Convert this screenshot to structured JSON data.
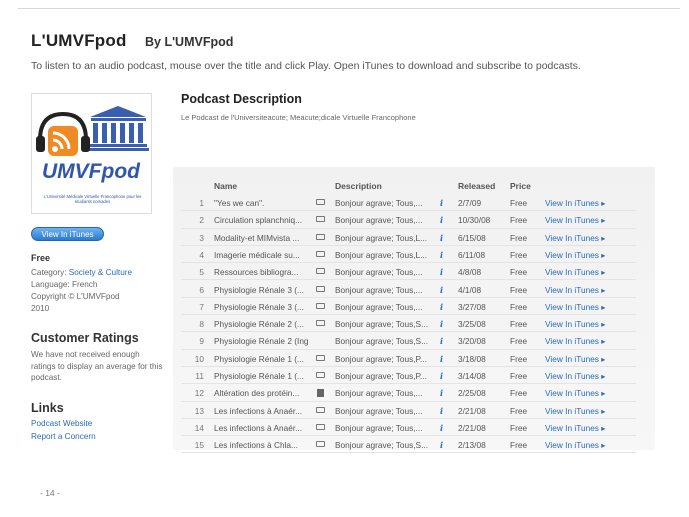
{
  "header": {
    "title": "L'UMVFpod",
    "by": "By L'UMVFpod",
    "subtitle": "To listen to an audio podcast, mouse over the title and click Play. Open iTunes to download and subscribe to podcasts."
  },
  "artwork": {
    "logo_text": "UMVFpod",
    "caption": "L'Université Médicale Virtuelle Francophone pour les étudiants nomades"
  },
  "sidebar": {
    "view_button": "View In iTunes",
    "price": "Free",
    "category_label": "Category: ",
    "category_value": "Society & Culture",
    "language": "Language: French",
    "copyright": "Copyright © L'UMVFpod",
    "year": "2010",
    "ratings_heading": "Customer Ratings",
    "ratings_text": "We have not received enough ratings to display an average for this podcast.",
    "links_heading": "Links",
    "links": [
      "Podcast Website",
      "Report a Concern"
    ]
  },
  "description": {
    "heading": "Podcast Description",
    "text": "Le Podcast de l'Universiteacute; Meacute;dicale Virtuelle Francophone"
  },
  "table": {
    "columns": {
      "name": "Name",
      "description": "Description",
      "released": "Released",
      "price": "Price"
    },
    "view_label": "View In iTunes ▸",
    "rows": [
      {
        "num": "1",
        "name": "\"Yes we can\".",
        "icon": "video",
        "desc": "Bonjour agrave; Tous,...",
        "rel": "2/7/09",
        "price": "Free"
      },
      {
        "num": "2",
        "name": "Circulation splanchniq...",
        "icon": "video",
        "desc": "Bonjour agrave; Tous,...",
        "rel": "10/30/08",
        "price": "Free"
      },
      {
        "num": "3",
        "name": "Modality-et MIMvista ...",
        "icon": "video",
        "desc": "Bonjour agrave; Tous,L...",
        "rel": "6/15/08",
        "price": "Free"
      },
      {
        "num": "4",
        "name": "Imagerie médicale su...",
        "icon": "video",
        "desc": "Bonjour agrave; Tous,L...",
        "rel": "6/11/08",
        "price": "Free"
      },
      {
        "num": "5",
        "name": "Ressources bibliogra...",
        "icon": "video",
        "desc": "Bonjour agrave; Tous,...",
        "rel": "4/8/08",
        "price": "Free"
      },
      {
        "num": "6",
        "name": "Physiologie Rénale 3 (...",
        "icon": "video",
        "desc": "Bonjour agrave; Tous,...",
        "rel": "4/1/08",
        "price": "Free"
      },
      {
        "num": "7",
        "name": "Physiologie Rénale 3 (...",
        "icon": "video",
        "desc": "Bonjour agrave; Tous,...",
        "rel": "3/27/08",
        "price": "Free"
      },
      {
        "num": "8",
        "name": "Physiologie Rénale 2 (...",
        "icon": "video",
        "desc": "Bonjour agrave; Tous,S...",
        "rel": "3/25/08",
        "price": "Free"
      },
      {
        "num": "9",
        "name": "Physiologie Rénale 2 (Ing...",
        "icon": "none",
        "desc": "Bonjour agrave; Tous,S...",
        "rel": "3/20/08",
        "price": "Free"
      },
      {
        "num": "10",
        "name": "Physiologie Rénale 1 (...",
        "icon": "video",
        "desc": "Bonjour agrave; Tous,P...",
        "rel": "3/18/08",
        "price": "Free"
      },
      {
        "num": "11",
        "name": "Physiologie Rénale 1 (...",
        "icon": "video",
        "desc": "Bonjour agrave; Tous,P...",
        "rel": "3/14/08",
        "price": "Free"
      },
      {
        "num": "12",
        "name": "Altération des protéin...",
        "icon": "doc",
        "desc": "Bonjour agrave; Tous,...",
        "rel": "2/25/08",
        "price": "Free"
      },
      {
        "num": "13",
        "name": "Les infections à Anaér...",
        "icon": "video",
        "desc": "Bonjour agrave; Tous,...",
        "rel": "2/21/08",
        "price": "Free"
      },
      {
        "num": "14",
        "name": "Les infections à Anaér...",
        "icon": "video",
        "desc": "Bonjour agrave; Tous,...",
        "rel": "2/21/08",
        "price": "Free"
      },
      {
        "num": "15",
        "name": "Les infections à Chla...",
        "icon": "video",
        "desc": "Bonjour agrave; Tous,S...",
        "rel": "2/13/08",
        "price": "Free"
      }
    ]
  },
  "footer": {
    "page": "- 14 -"
  }
}
